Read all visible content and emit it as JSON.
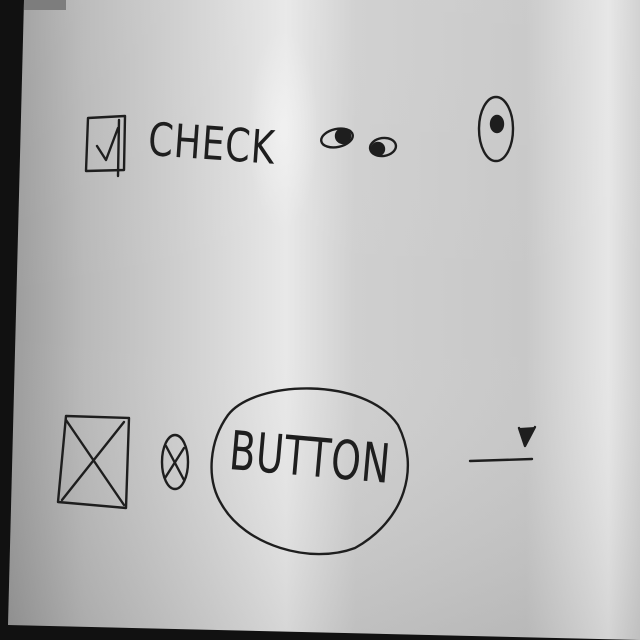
{
  "sketch": {
    "checkbox_label": "CHECK",
    "button_label": "BUTTON"
  },
  "widgets": {
    "checkbox_checked": true,
    "radio_selected": true,
    "toggle_state": "on",
    "image_placeholder": "crossed-box",
    "slider_level": 0.85
  },
  "icons": {
    "checkbox": "checkmark-icon",
    "toggle": "toggle-icon",
    "radio": "radio-dot-icon",
    "image": "image-placeholder-icon",
    "close": "close-x-icon",
    "slider_handle": "slider-handle-icon"
  },
  "colors": {
    "ink": "#1e1e1e",
    "paper": "#d0d0d0",
    "background": "#0d0d0d"
  }
}
